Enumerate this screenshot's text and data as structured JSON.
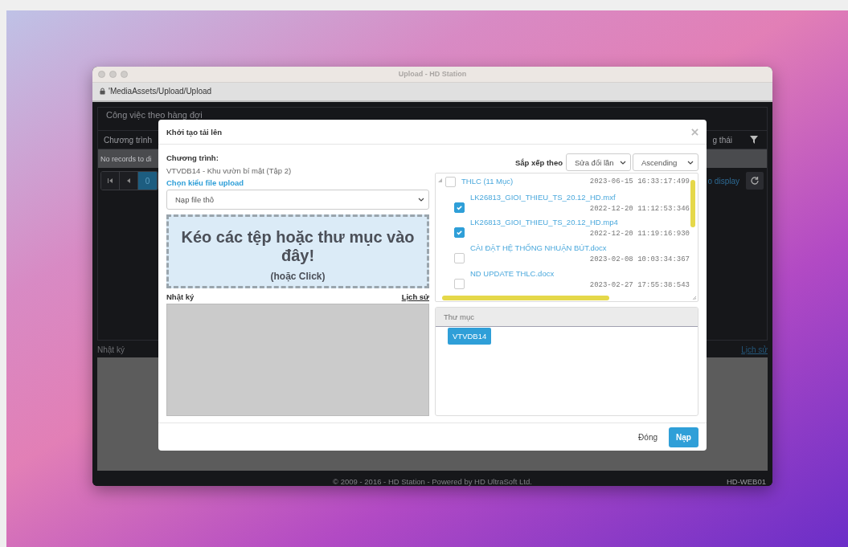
{
  "window": {
    "title": "Upload - HD Station",
    "address": "'MediaAssets/Upload/Upload"
  },
  "app": {
    "panel_title": "Công việc theo hàng đợi",
    "columns": [
      {
        "label": "Chương trình"
      },
      {
        "label": "g thái"
      }
    ],
    "empty_row": "No records to di",
    "pages": [
      {
        "label": "0",
        "selected": true
      }
    ],
    "pager_info": "o display",
    "log_label": "Nhật ký",
    "history_link": "Lịch sử",
    "footer": "© 2009 - 2016 - HD Station - Powered by HD UltraSoft Ltd.",
    "server": "HD-WEB01"
  },
  "dialog": {
    "title": "Khởi tạo tải lên",
    "program_label": "Chương trình:",
    "program_value": "VTVDB14 - Khu vườn bí mật (Tập 2)",
    "upload_type_label": "Chọn kiểu file upload",
    "upload_type_value": "Nạp file thô",
    "dropzone_title": "Kéo các tệp hoặc thư mục vào đây!",
    "dropzone_hint": "(hoặc Click)",
    "log_label": "Nhật ký",
    "history_link": "Lịch sử",
    "sort_label": "Sắp xếp theo",
    "sort_field": "Sửa đổi lần",
    "sort_order": "Ascending",
    "tree": [
      {
        "label": "THLC (11 Mục)",
        "date": "2023-06-15 16:33:17:499",
        "checked": false,
        "expanded": true,
        "children": [
          {
            "label": "LK26813_GIOI_THIEU_TS_20.12_HD.mxf",
            "date": "2022-12-20 11:12:53:346",
            "checked": true
          },
          {
            "label": "LK26813_GIOI_THIEU_TS_20.12_HD.mp4",
            "date": "2022-12-20 11:19:16:930",
            "checked": true
          },
          {
            "label": "CÀI ĐẶT HỆ THỐNG NHUẬN BÚT.docx",
            "date": "2023-02-08 10:03:34:367",
            "checked": false
          },
          {
            "label": "ND UPDATE THLC.docx",
            "date": "2023-02-27 17:55:38:543",
            "checked": false
          }
        ]
      }
    ],
    "folder_header": "Thư mục",
    "folders": [
      "VTVDB14"
    ],
    "buttons": [
      {
        "label": "Đóng",
        "kind": "link"
      },
      {
        "label": "Nạp",
        "kind": "primary"
      }
    ]
  }
}
